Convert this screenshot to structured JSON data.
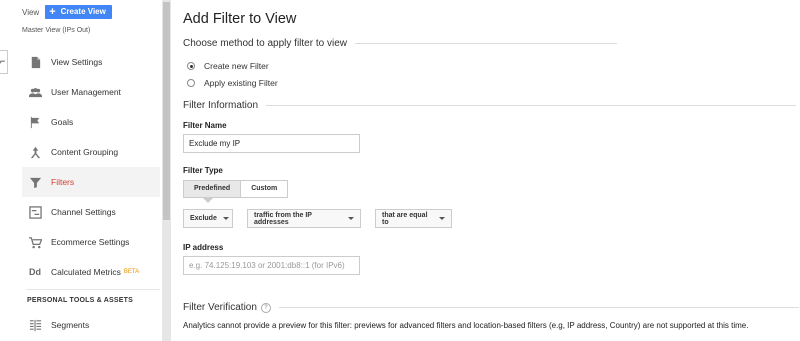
{
  "sidebar": {
    "edge_button": "⌐",
    "view_label": "View",
    "create_view": "Create View",
    "master_view": "Master View (IPs Out)",
    "items": [
      {
        "label": "View Settings",
        "icon": "document-icon"
      },
      {
        "label": "User Management",
        "icon": "people-icon"
      },
      {
        "label": "Goals",
        "icon": "flag-icon"
      },
      {
        "label": "Content Grouping",
        "icon": "grouping-icon"
      },
      {
        "label": "Filters",
        "icon": "filter-icon",
        "active": true
      },
      {
        "label": "Channel Settings",
        "icon": "channel-icon"
      },
      {
        "label": "Ecommerce Settings",
        "icon": "cart-icon"
      },
      {
        "label": "Calculated Metrics",
        "icon": "dd-icon",
        "badge": "BETA"
      }
    ],
    "section_personal": "PERSONAL TOOLS & ASSETS",
    "segments": "Segments"
  },
  "main": {
    "title": "Add Filter to View",
    "method_header": "Choose method to apply filter to view",
    "option_create": "Create new Filter",
    "option_apply": "Apply existing Filter",
    "info_header": "Filter Information",
    "filter_name_label": "Filter Name",
    "filter_name_value": "Exclude my IP",
    "filter_type_label": "Filter Type",
    "type_predefined": "Predefined",
    "type_custom": "Custom",
    "dd_exclude": "Exclude",
    "dd_source": "traffic from the IP addresses",
    "dd_condition": "that are equal to",
    "ip_label": "IP address",
    "ip_placeholder": "e.g. 74.125:19.103 or 2001:db8::1 (for IPv6)",
    "verify_header": "Filter Verification",
    "verify_help": "?",
    "verify_text": "Analytics cannot provide a preview for this filter: previews for advanced filters and location-based filters (e.g, IP address, Country) are not supported at this time."
  }
}
